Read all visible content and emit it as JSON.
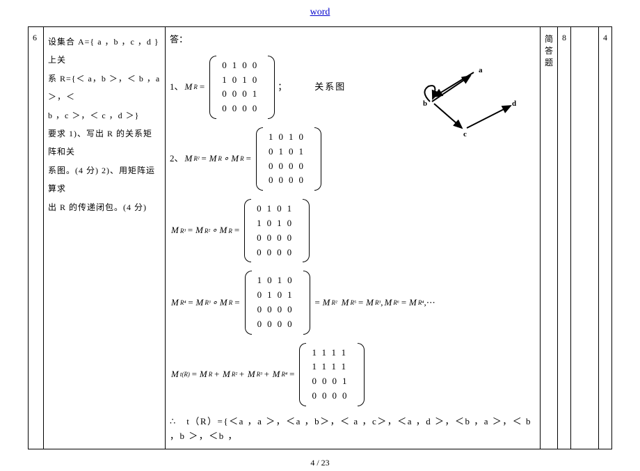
{
  "header": {
    "link_text": "word"
  },
  "row": {
    "number": "6",
    "question": {
      "line1": "设集合 A={ a ，b ，c ，d }上关",
      "line2": "系 R={＜ a，b ＞，＜ b ，a ＞，＜",
      "line3": "b ，c ＞，＜ c ，d ＞}",
      "line4": "要求 1)、写出 R 的关系矩阵和关",
      "line5": "系图。(4 分)  2)、用矩阵运算求",
      "line6": "出 R 的传递闭包。(4 分)"
    },
    "answer": {
      "intro": "答：",
      "item1_prefix": "1、",
      "MR_label": "M",
      "MR_sub": "R",
      "MR_matrix": [
        [
          "0",
          "1",
          "0",
          "0"
        ],
        [
          "1",
          "0",
          "1",
          "0"
        ],
        [
          "0",
          "0",
          "0",
          "1"
        ],
        [
          "0",
          "0",
          "0",
          "0"
        ]
      ],
      "item1_suffix": "；",
      "relation_label": "关系图",
      "graph_labels": {
        "a": "a",
        "b": "b",
        "c": "c",
        "d": "d"
      },
      "item2_prefix": "2、",
      "MR2_sub": "R²",
      "compose_text1": " = M",
      "compose_text2": " ∘ M",
      "MR2_matrix": [
        [
          "1",
          "0",
          "1",
          "0"
        ],
        [
          "0",
          "1",
          "0",
          "1"
        ],
        [
          "0",
          "0",
          "0",
          "0"
        ],
        [
          "0",
          "0",
          "0",
          "0"
        ]
      ],
      "MR3_sub": "R³",
      "MR3_matrix": [
        [
          "0",
          "1",
          "0",
          "1"
        ],
        [
          "1",
          "0",
          "1",
          "0"
        ],
        [
          "0",
          "0",
          "0",
          "0"
        ],
        [
          "0",
          "0",
          "0",
          "0"
        ]
      ],
      "MR4_sub": "R⁴",
      "MR4_matrix": [
        [
          "1",
          "0",
          "1",
          "0"
        ],
        [
          "0",
          "1",
          "0",
          "1"
        ],
        [
          "0",
          "0",
          "0",
          "0"
        ],
        [
          "0",
          "0",
          "0",
          "0"
        ]
      ],
      "MR4_tail": " = M",
      "MR5_sub": "R⁵",
      "MR6_sub": "R⁶",
      "dots": " ,⋯",
      "Mt_sub": "t(R)",
      "plus": " + ",
      "Mt_matrix": [
        [
          "1",
          "1",
          "1",
          "1"
        ],
        [
          "1",
          "1",
          "1",
          "1"
        ],
        [
          "0",
          "0",
          "0",
          "1"
        ],
        [
          "0",
          "0",
          "0",
          "0"
        ]
      ],
      "conclusion": "∴　t（R）={＜a ，a ＞，＜a ，b＞，＜ a ，c＞，＜a ，d ＞，＜b ，a ＞，＜ b ，b ＞，＜b ，"
    },
    "type_label": "简答题",
    "score": "8",
    "last": "4"
  },
  "footer": {
    "page": "4 / 23"
  }
}
